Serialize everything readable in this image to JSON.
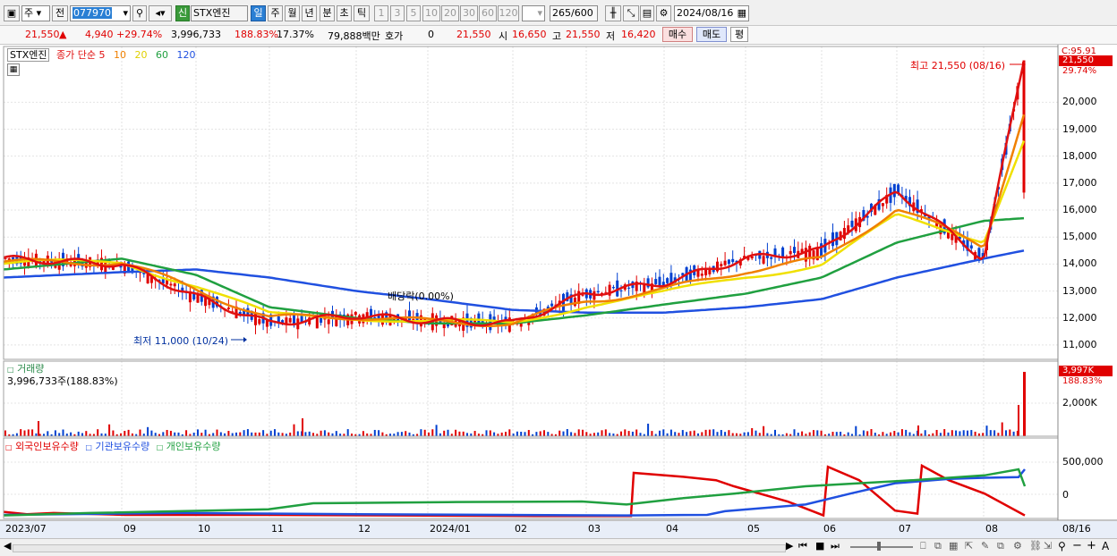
{
  "toolbar": {
    "type_label": "주",
    "all_label": "전",
    "code": "077970",
    "new_badge": "신",
    "stock_name": "STX엔진",
    "periods": [
      "일",
      "주",
      "월",
      "년",
      "분",
      "초",
      "틱"
    ],
    "active_period": "일",
    "intervals": [
      "1",
      "3",
      "5",
      "10",
      "20",
      "30",
      "60",
      "120"
    ],
    "count": "265",
    "count_max": "/600",
    "date": "2024/08/16"
  },
  "quote": {
    "price": "21,550",
    "change": "4,940",
    "change_pct": "+29.74%",
    "volume": "3,996,733",
    "volume_ratio": "188.83%",
    "turnover": "17.37%",
    "amount": "79,888백만",
    "hoga_label": "호가",
    "hoga_value": "0",
    "hoga_price": "21,550",
    "open_label": "시",
    "open": "16,650",
    "high_label": "고",
    "high": "21,550",
    "low_label": "저",
    "low": "16,420",
    "buy_label": "매수",
    "sell_label": "매도",
    "eval_label": "평"
  },
  "legend": {
    "name": "STX엔진",
    "ma_title": "종가 단순",
    "ma5": "5",
    "ma10": "10",
    "ma20": "20",
    "ma60": "60",
    "ma120": "120"
  },
  "colors": {
    "ma5": "#e01010",
    "ma10": "#f08000",
    "ma20": "#f0e000",
    "ma60": "#20a040",
    "ma120": "#2050e0",
    "up": "#e00000",
    "down": "#0040d0"
  },
  "price_panel": {
    "annot_high": "최고 21,550 (08/16)",
    "annot_low": "최저 11,000 (10/24)",
    "annot_div": "배당락(0.00%)",
    "top_label": "C:95.91",
    "current_tag": "21,550",
    "current_pct": "29.74%",
    "yticks": [
      "20,000",
      "19,000",
      "18,000",
      "17,000",
      "16,000",
      "15,000",
      "14,000",
      "13,000",
      "12,000",
      "11,000"
    ]
  },
  "volume_panel": {
    "title": "거래량",
    "value": "3,996,733주(188.83%)",
    "tag": "3,997K",
    "tag_pct": "188.83%",
    "ytick": "2,000K"
  },
  "holding_panel": {
    "title1": "외국인보유수량",
    "title2": "기관보유수량",
    "title3": "개인보유수량",
    "yticks": [
      "500,000",
      "0"
    ]
  },
  "xaxis": {
    "labels": [
      "2023/07",
      "09",
      "10",
      "11",
      "12",
      "2024/01",
      "02",
      "03",
      "04",
      "05",
      "06",
      "07",
      "08"
    ],
    "end_label": "08/16"
  },
  "chart_data": {
    "type": "line",
    "series": [
      {
        "name": "5",
        "x": [
          "2023/07",
          "09",
          "10",
          "11",
          "12",
          "2024/01",
          "02",
          "03",
          "04",
          "05",
          "06",
          "07",
          "08",
          "08/16"
        ],
        "values": [
          14200,
          14000,
          12800,
          11800,
          12100,
          11900,
          11800,
          12900,
          13300,
          14200,
          14500,
          16700,
          14200,
          21550
        ]
      },
      {
        "name": "60",
        "x": [
          "2023/07",
          "09",
          "10",
          "11",
          "12",
          "2024/01",
          "02",
          "03",
          "04",
          "05",
          "06",
          "07",
          "08",
          "08/16"
        ],
        "values": [
          13800,
          14200,
          13600,
          12400,
          12000,
          11800,
          11800,
          12100,
          12500,
          12900,
          13500,
          14800,
          15600,
          15700
        ]
      },
      {
        "name": "120",
        "x": [
          "2023/07",
          "09",
          "10",
          "11",
          "12",
          "2024/01",
          "02",
          "03",
          "04",
          "05",
          "06",
          "07",
          "08",
          "08/16"
        ],
        "values": [
          13500,
          13700,
          13800,
          13500,
          13000,
          12700,
          12300,
          12200,
          12200,
          12400,
          12700,
          13500,
          14200,
          14500
        ]
      }
    ],
    "ylim": [
      10600,
      21800
    ]
  }
}
